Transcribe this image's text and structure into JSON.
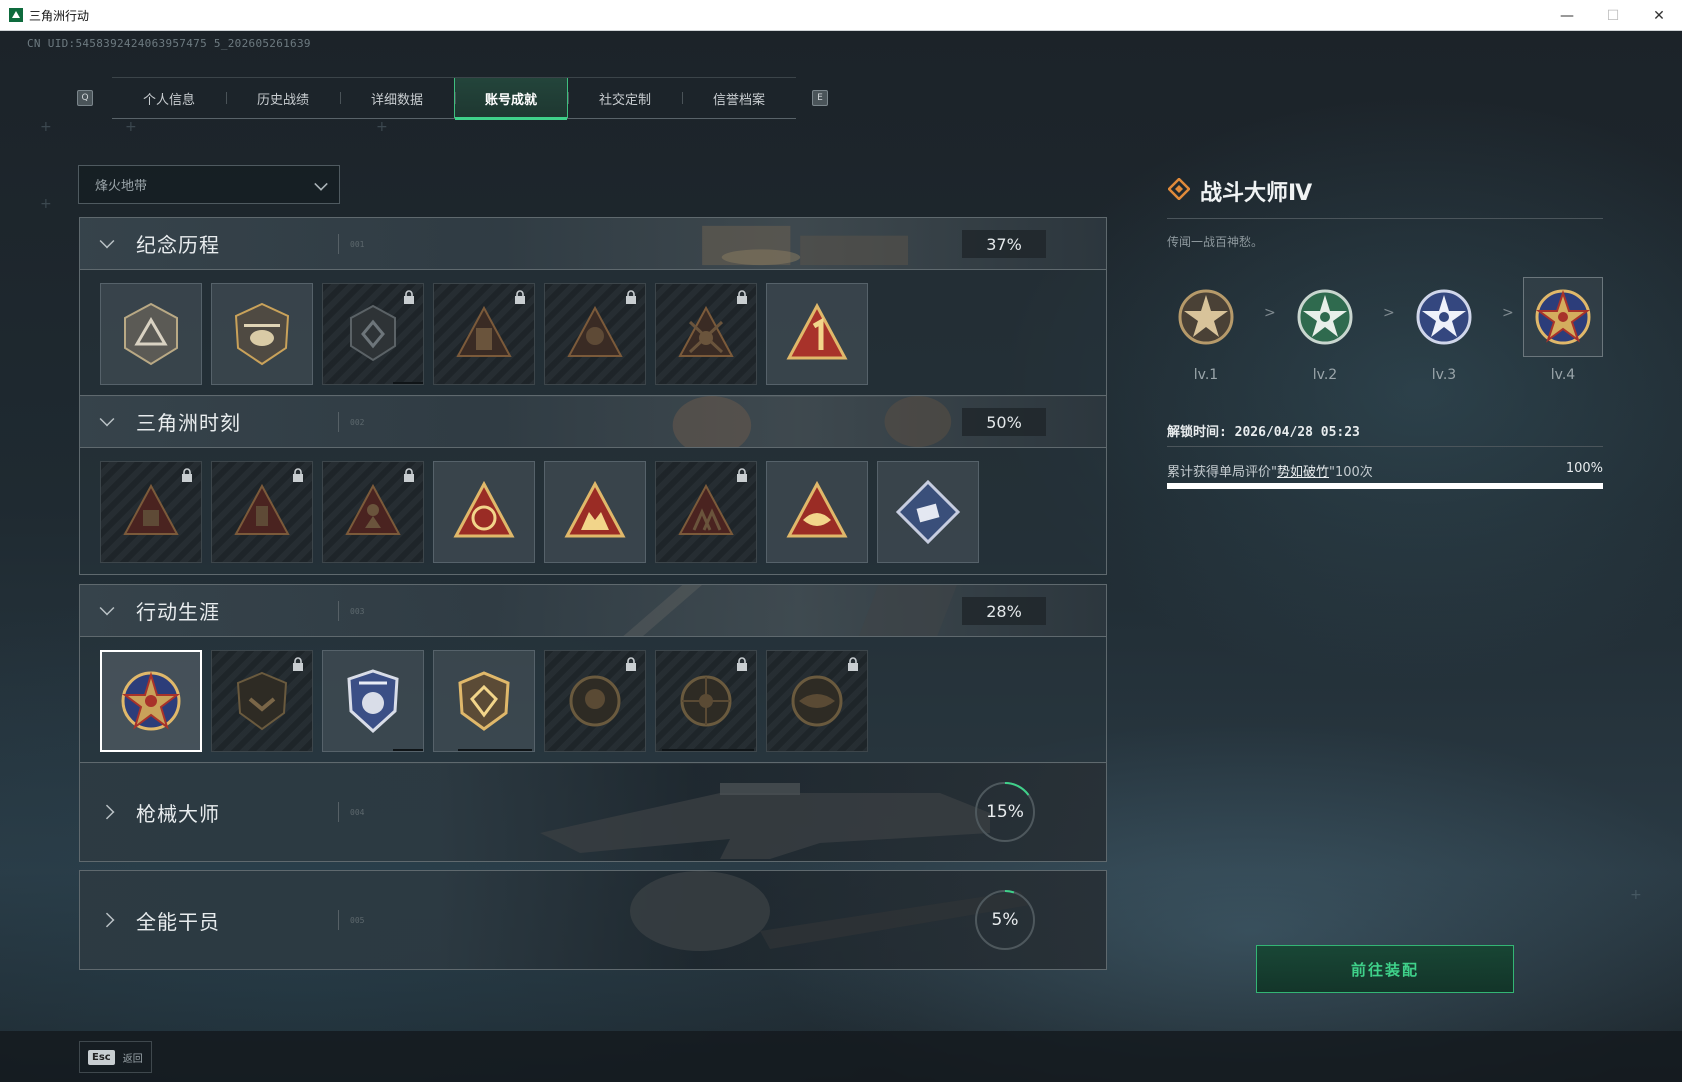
{
  "window": {
    "title": "三角洲行动",
    "controls": [
      "—",
      "☐",
      "✕"
    ]
  },
  "uid": "CN UID:5458392424063957475 5_202605261639",
  "tabs": [
    "个人信息",
    "历史战绩",
    "详细数据",
    "账号成就",
    "社交定制",
    "信誉档案"
  ],
  "active_tab": "账号成就",
  "keyhints": {
    "left": "Q",
    "right": "E"
  },
  "dropdown": {
    "value": "烽火地带"
  },
  "sections": [
    {
      "title": "纪念历程",
      "code": "001",
      "percent": "37%",
      "expanded": true
    },
    {
      "title": "三角洲时刻",
      "code": "002",
      "percent": "50%",
      "expanded": true
    },
    {
      "title": "行动生涯",
      "code": "003",
      "percent": "28%",
      "expanded": true
    },
    {
      "title": "枪械大师",
      "code": "004",
      "percent": "15%",
      "expanded": false,
      "progress": 0.15
    },
    {
      "title": "全能干员",
      "code": "005",
      "percent": "5%",
      "expanded": false,
      "progress": 0.05
    }
  ],
  "detail": {
    "title": "战斗大师Ⅳ",
    "description": "传闻一战百神愁。",
    "levels": [
      "lv.1",
      "lv.2",
      "lv.3",
      "lv.4"
    ],
    "unlock_label": "解锁时间: ",
    "unlock_time": "2026/04/28 05:23",
    "requirement_prefix": "累计获得单局评价\"",
    "requirement_link": "势如破竹",
    "requirement_suffix": "\"100次",
    "requirement_percent": "100%",
    "requirement_progress": 1.0,
    "equip_button": "前往装配"
  },
  "footer": {
    "esc_key": "Esc",
    "esc_label": "返回"
  },
  "colors": {
    "accent": "#3fd18a",
    "gold": "#c9a25a",
    "red": "#a8322a",
    "navy": "#2c3d7a"
  }
}
